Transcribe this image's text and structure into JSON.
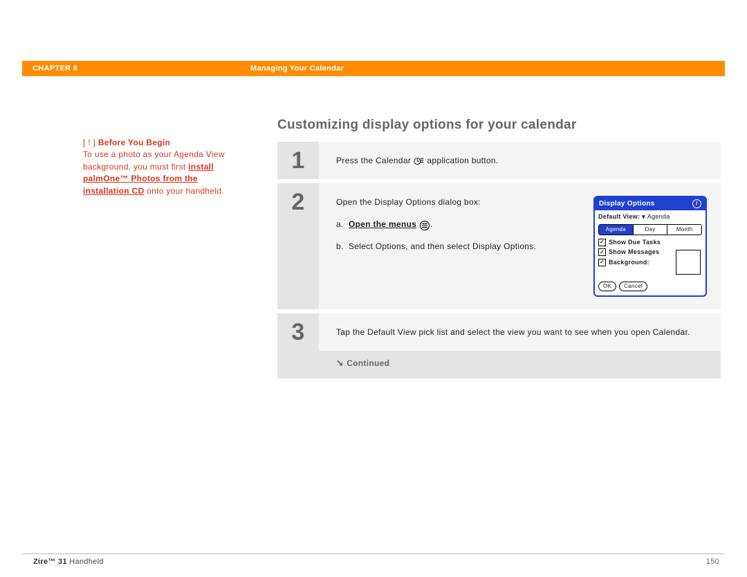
{
  "header": {
    "chapter": "CHAPTER 8",
    "title": "Managing Your Calendar"
  },
  "sidebar": {
    "before_marker": "[ ! ]",
    "before_title": "Before You Begin",
    "body_pre": "To use a photo as your Agenda View background, you must first ",
    "body_link": "install palmOne™ Photos from the installation CD",
    "body_post": " onto your handheld."
  },
  "main": {
    "title": "Customizing display options for your calendar"
  },
  "steps": [
    {
      "num": "1",
      "text_a": "Press the Calendar ",
      "text_b": " application button."
    },
    {
      "num": "2",
      "intro": "Open the Display Options dialog box:",
      "a_prefix": "a.",
      "a_label": "Open the menus",
      "a_period": ".",
      "b_prefix": "b.",
      "b_text": "Select Options, and then select Display Options."
    },
    {
      "num": "3",
      "text": "Tap the Default View pick list and select the view you want to see when you open Calendar."
    }
  ],
  "continued": "Continued",
  "dialog": {
    "title": "Display Options",
    "default_view_label": "Default View:",
    "default_view_value": "Agenda",
    "tabs": [
      "Agenda",
      "Day",
      "Month"
    ],
    "checks": [
      "Show Due Tasks",
      "Show Messages",
      "Background:"
    ],
    "ok": "OK",
    "cancel": "Cancel"
  },
  "footer": {
    "product_bold": "Zire™ 31",
    "product_rest": " Handheld",
    "page": "150"
  }
}
